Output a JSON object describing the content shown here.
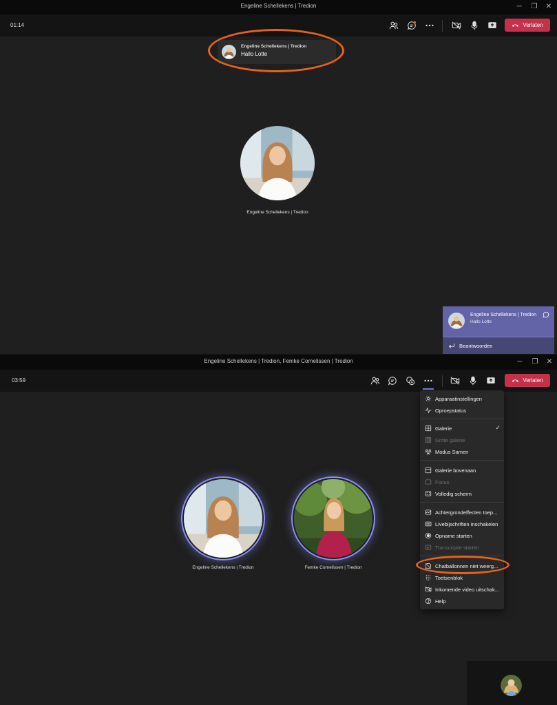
{
  "window1": {
    "title": "Engeline Schellekens | Tredion",
    "timer": "01:14",
    "leave_label": "Verlaten",
    "chat_bubble": {
      "sender": "Engeline Schellekens | Tredion",
      "message": "Hallo Lotte"
    },
    "participant": {
      "name": "Engeline Schellekens | Tredion"
    },
    "toast": {
      "sender": "Engeline Schellekens | Tredion",
      "message": "Hallo Lotte",
      "reply_label": "Beantwoorden"
    }
  },
  "window2": {
    "title": "Engeline Schellekens | Tredion, Femke Cornelissen | Tredion",
    "timer": "03:59",
    "leave_label": "Verlaten",
    "participants": [
      {
        "name": "Engeline Schellekens | Tredion"
      },
      {
        "name": "Femke Cornelissen | Tredion"
      }
    ],
    "menu": {
      "items": [
        {
          "label": "Apparaatinstellingen",
          "icon": "gear-icon",
          "enabled": true
        },
        {
          "label": "Oproepstatus",
          "icon": "pulse-icon",
          "enabled": true
        },
        {
          "label": "Galerie",
          "icon": "grid-icon",
          "enabled": true,
          "checked": true
        },
        {
          "label": "Grote galerie",
          "icon": "large-grid-icon",
          "enabled": false
        },
        {
          "label": "Modus Samen",
          "icon": "together-mode-icon",
          "enabled": true
        },
        {
          "label": "Galerie bovenaan",
          "icon": "gallery-top-icon",
          "enabled": true
        },
        {
          "label": "Focus",
          "icon": "focus-icon",
          "enabled": false
        },
        {
          "label": "Volledig scherm",
          "icon": "fullscreen-icon",
          "enabled": true
        },
        {
          "label": "Achtergrondeffecten toep...",
          "icon": "background-effects-icon",
          "enabled": true
        },
        {
          "label": "Livebijschriften inschakelen",
          "icon": "captions-icon",
          "enabled": true
        },
        {
          "label": "Opname starten",
          "icon": "record-icon",
          "enabled": true
        },
        {
          "label": "Transcriptie starten",
          "icon": "transcript-icon",
          "enabled": false
        },
        {
          "label": "Chatballonnen niet weerg...",
          "icon": "chat-bubble-off-icon",
          "enabled": true
        },
        {
          "label": "Toetsenblok",
          "icon": "keypad-icon",
          "enabled": true
        },
        {
          "label": "Inkomende video uitschak...",
          "icon": "video-off-icon",
          "enabled": true
        },
        {
          "label": "Help",
          "icon": "help-icon",
          "enabled": true
        }
      ]
    }
  },
  "colors": {
    "leave": "#c4314b",
    "accent": "#6264a7",
    "annotation": "#e8601c",
    "background": "#1f1f1f"
  }
}
